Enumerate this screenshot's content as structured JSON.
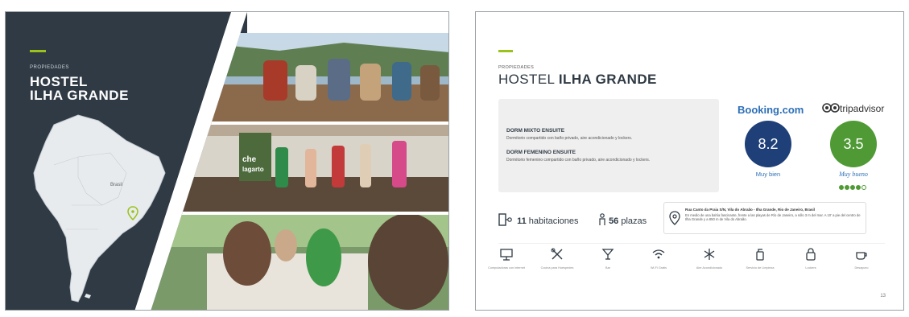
{
  "left_page": {
    "section_label": "PROPIEDADES",
    "title_line1": "HOSTEL",
    "title_line2": "ILHA GRANDE",
    "map_label": "Brasil",
    "photo_sign_line1": "che",
    "photo_sign_line2": "lagarto"
  },
  "right_page": {
    "section_label": "PROPIEDADES",
    "title_light": "HOSTEL",
    "title_bold": "ILHA GRANDE",
    "rooms": [
      {
        "title": "DORM MIXTO ENSUITE",
        "description": "Dormitorio compartido con baño privado, aire acondicionado y lockers."
      },
      {
        "title": "DORM FEMENINO ENSUITE",
        "description": "Dormitorio femenino compartido con baño privado, aire acondicionado y lockers."
      }
    ],
    "booking": {
      "brand": "Booking.com",
      "score": "8.2",
      "caption": "Muy bien",
      "color": "#1e3f77"
    },
    "tripadvisor": {
      "brand": "tripadvisor",
      "score": "3.5",
      "caption": "Muy bueno",
      "rating_of_5": 3.5,
      "color": "#4f9a35"
    },
    "stats": {
      "rooms_count": "11",
      "rooms_label": "habitaciones",
      "beds_count": "56",
      "beds_label": "plazas"
    },
    "address": {
      "title": "Rua Canto da Praia S/N, Vila do Abraão - Ilha Grande, Rio de Janeiro, Brasil",
      "description": "En medio de una bahía fascinante, frente a las playas de Río de Janeiro, a sólo 3 m del mar. A 10' a pie del centro de Ilha Grande y a 850 m de Vila do Abraão."
    },
    "amenities": [
      {
        "icon": "computer-icon",
        "label": "Computadoras con internet"
      },
      {
        "icon": "kitchen-icon",
        "label": "Cocina para Huéspedes"
      },
      {
        "icon": "bar-icon",
        "label": "Bar"
      },
      {
        "icon": "wifi-icon",
        "label": "Wi-Fi Gratis"
      },
      {
        "icon": "snowflake-icon",
        "label": "Aire Acondicionado"
      },
      {
        "icon": "cleaning-icon",
        "label": "Servicio de Limpieza"
      },
      {
        "icon": "locker-icon",
        "label": "Lockers"
      },
      {
        "icon": "breakfast-icon",
        "label": "Desayuno"
      }
    ],
    "page_number": "13"
  }
}
